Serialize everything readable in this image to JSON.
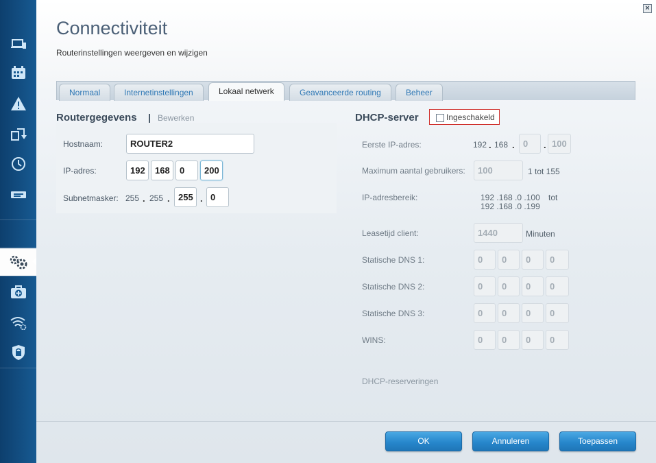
{
  "window": {
    "close_glyph": "×"
  },
  "header": {
    "title": "Connectiviteit",
    "subtitle": "Routerinstellingen weergeven en wijzigen"
  },
  "tabs": [
    {
      "label": "Normaal",
      "active": false
    },
    {
      "label": "Internetinstellingen",
      "active": false
    },
    {
      "label": "Lokaal netwerk",
      "active": true
    },
    {
      "label": "Geavanceerde routing",
      "active": false
    },
    {
      "label": "Beheer",
      "active": false
    }
  ],
  "router": {
    "heading": "Routergegevens",
    "separator": "|",
    "edit_label": "Bewerken",
    "hostname_label": "Hostnaam:",
    "hostname_value": "ROUTER2",
    "ip_label": "IP-adres:",
    "ip": [
      "192",
      "168",
      "0",
      "200"
    ],
    "subnet_label": "Subnetmasker:",
    "subnet_static": [
      "255",
      "255"
    ],
    "subnet_inputs": [
      "255",
      "0"
    ],
    "dot": "."
  },
  "dhcp": {
    "heading": "DHCP-server",
    "enabled_label": "Ingeschakeld",
    "enabled": false,
    "first_ip_label": "Eerste IP-adres:",
    "first_ip_static": [
      "192",
      "168"
    ],
    "first_ip_inputs": [
      "0",
      "100"
    ],
    "max_users_label": "Maximum aantal gebruikers:",
    "max_users_value": "100",
    "max_users_range": "1 tot 155",
    "range_label": "IP-adresbereik:",
    "range_start": "192 .168 .0 .100",
    "range_to": "tot",
    "range_end": "192 .168 .0 .199",
    "lease_label": "Leasetijd client:",
    "lease_value": "1440",
    "lease_unit": "Minuten",
    "dns1_label": "Statische DNS 1:",
    "dns1": [
      "0",
      "0",
      "0",
      "0"
    ],
    "dns2_label": "Statische DNS 2:",
    "dns2": [
      "0",
      "0",
      "0",
      "0"
    ],
    "dns3_label": "Statische DNS 3:",
    "dns3": [
      "0",
      "0",
      "0",
      "0"
    ],
    "wins_label": "WINS:",
    "wins": [
      "0",
      "0",
      "0",
      "0"
    ],
    "reservations_label": "DHCP-reserveringen"
  },
  "footer": {
    "ok_label": "OK",
    "cancel_label": "Annuleren",
    "apply_label": "Toepassen"
  },
  "colors": {
    "sidebar": "#175a92",
    "accent_button": "#2787cc",
    "tab_link": "#2f78b5",
    "highlight_border": "#d0312d"
  },
  "sidebar_icons": [
    "devices-icon",
    "calendar-icon",
    "warning-icon",
    "refresh-icon",
    "clock-icon",
    "usb-icon",
    "gears-icon",
    "medkit-icon",
    "wifi-icon",
    "shield-lock-icon"
  ]
}
